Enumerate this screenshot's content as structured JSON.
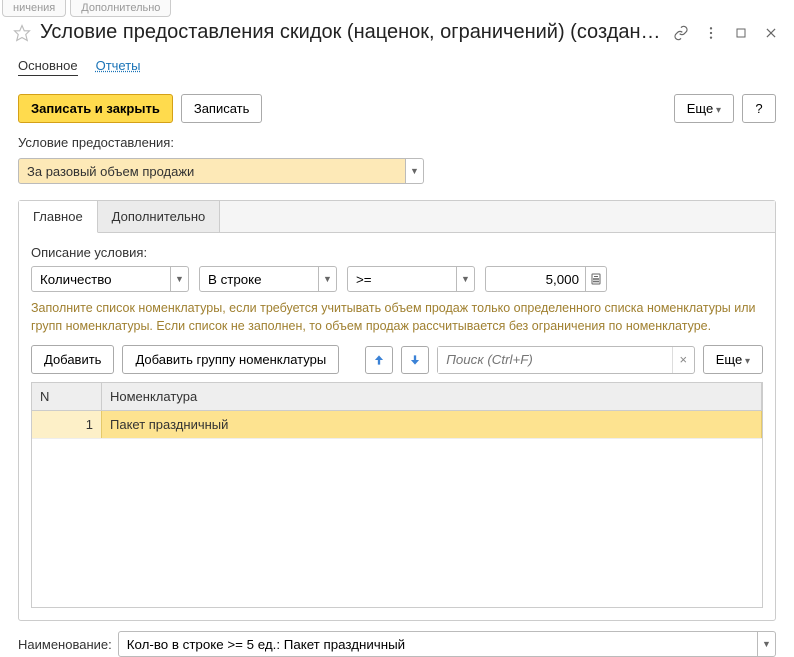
{
  "bg_tabs": [
    "ничения",
    "Дополнительно"
  ],
  "window": {
    "title": "Условие предоставления скидок (наценок, ограничений) (создан…"
  },
  "nav": {
    "main": "Основное",
    "reports": "Отчеты"
  },
  "toolbar": {
    "save_close": "Записать и закрыть",
    "save": "Записать",
    "more": "Еще",
    "help": "?"
  },
  "condition": {
    "label": "Условие предоставления:",
    "value": "За разовый объем продажи"
  },
  "tabs": {
    "main": "Главное",
    "extra": "Дополнительно"
  },
  "desc": {
    "label": "Описание условия:",
    "metric": "Количество",
    "scope": "В строке",
    "op": ">=",
    "value": "5,000"
  },
  "hint": "Заполните список номенклатуры, если требуется учитывать объем продаж только определенного списка номенклатуры или групп номенклатуры. Если список не заполнен, то объем продаж рассчитывается без ограничения по номенклатуре.",
  "row2": {
    "add": "Добавить",
    "add_group": "Добавить группу номенклатуры",
    "search_placeholder": "Поиск (Ctrl+F)",
    "more": "Еще"
  },
  "table": {
    "col_n": "N",
    "col_nom": "Номенклатура",
    "rows": [
      {
        "n": "1",
        "nom": "Пакет праздничный"
      }
    ]
  },
  "naming": {
    "label": "Наименование:",
    "value": "Кол-во в строке >= 5 ед.: Пакет праздничный"
  }
}
